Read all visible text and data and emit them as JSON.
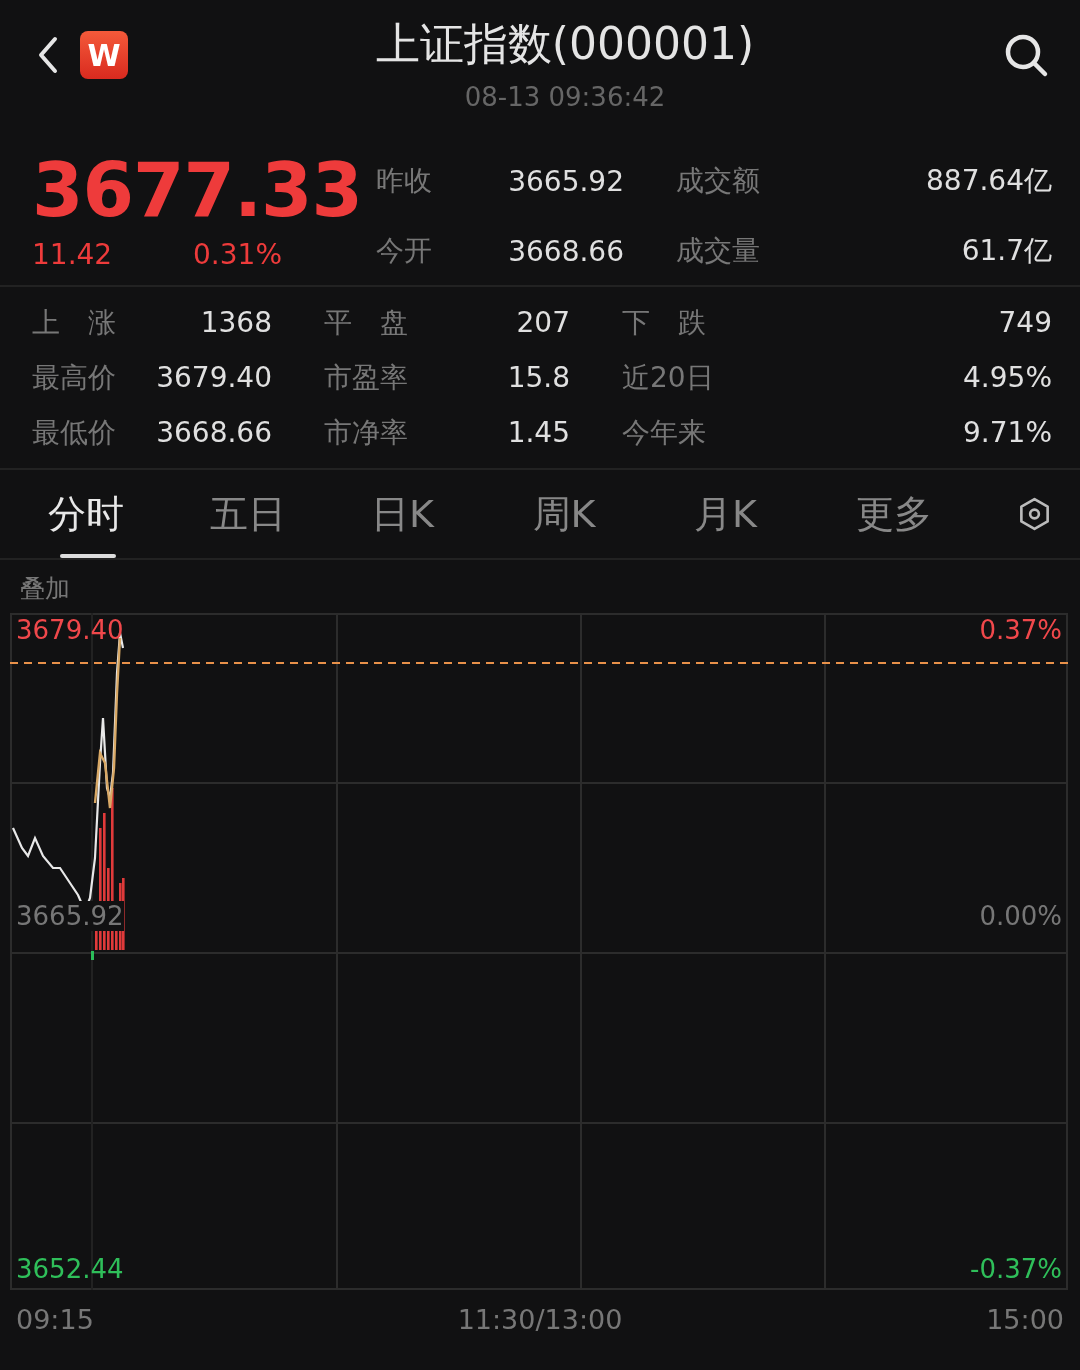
{
  "header": {
    "badge": "W",
    "title": "上证指数(000001)",
    "timestamp": "08-13 09:36:42"
  },
  "quote": {
    "price": "3677.33",
    "change": "11.42",
    "change_pct": "0.31%",
    "stats": [
      {
        "label": "昨收",
        "value": "3665.92"
      },
      {
        "label": "成交额",
        "value": "887.64亿"
      },
      {
        "label": "今开",
        "value": "3668.66"
      },
      {
        "label": "成交量",
        "value": "61.7亿"
      }
    ]
  },
  "stats": [
    {
      "label": "上　涨",
      "value": "1368"
    },
    {
      "label": "平　盘",
      "value": "207"
    },
    {
      "label": "下　跌",
      "value": "749"
    },
    {
      "label": "最高价",
      "value": "3679.40"
    },
    {
      "label": "市盈率",
      "value": "15.8"
    },
    {
      "label": "近20日",
      "value": "4.95%"
    },
    {
      "label": "最低价",
      "value": "3668.66"
    },
    {
      "label": "市净率",
      "value": "1.45"
    },
    {
      "label": "今年来",
      "value": "9.71%"
    }
  ],
  "tabs": [
    {
      "label": "分时",
      "selected": true
    },
    {
      "label": "五日",
      "selected": false
    },
    {
      "label": "日K",
      "selected": false
    },
    {
      "label": "周K",
      "selected": false
    },
    {
      "label": "月K",
      "selected": false
    },
    {
      "label": "更多",
      "selected": false
    }
  ],
  "chart": {
    "overlay": "叠加",
    "price_high": "3679.40",
    "pct_high": "0.37%",
    "price_base": "3665.92",
    "pct_base": "0.00%",
    "price_low": "3652.44",
    "pct_low": "-0.37%",
    "times": [
      "09:15",
      "11:30/13:00",
      "15:00"
    ]
  }
}
